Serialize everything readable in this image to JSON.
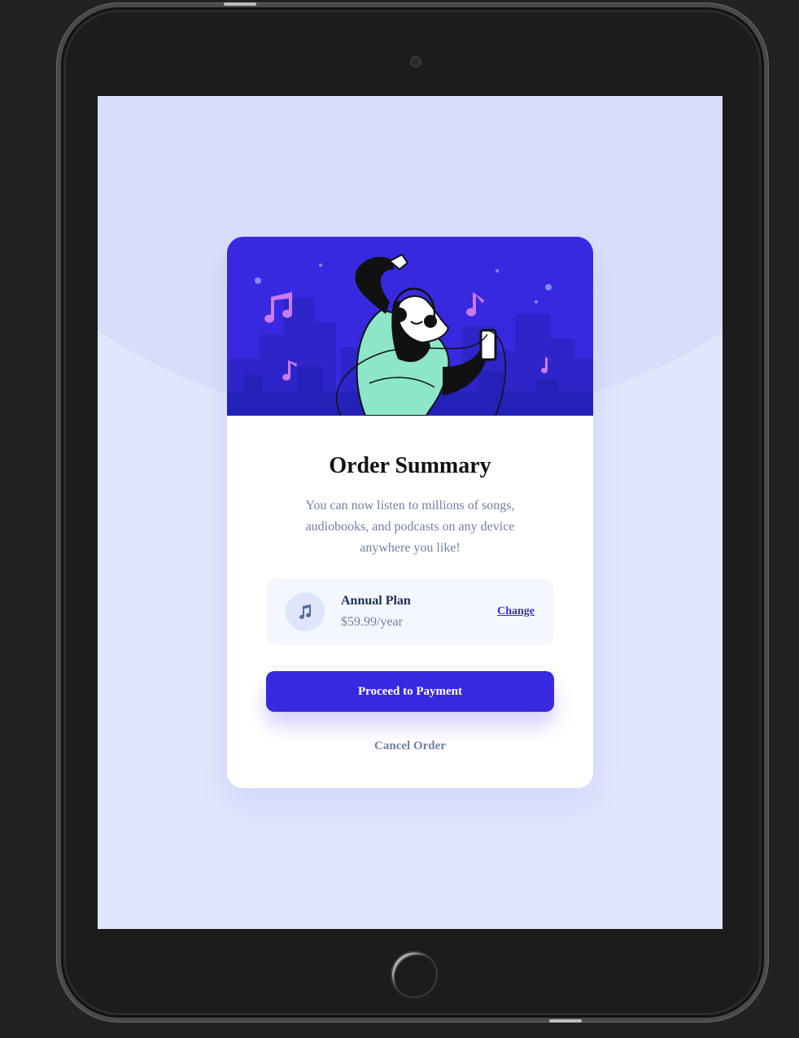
{
  "card": {
    "title": "Order Summary",
    "description": "You can now listen to millions of songs, audiobooks, and podcasts on any device anywhere you like!",
    "plan": {
      "icon": "music-note-icon",
      "name": "Annual Plan",
      "price": "$59.99/year",
      "change_label": "Change"
    },
    "pay_label": "Proceed to Payment",
    "cancel_label": "Cancel Order"
  },
  "colors": {
    "accent": "#3829e0",
    "screen_bg": "#e0e6fc",
    "muted_text": "#717fa6",
    "dark_text": "#1f2f56"
  }
}
